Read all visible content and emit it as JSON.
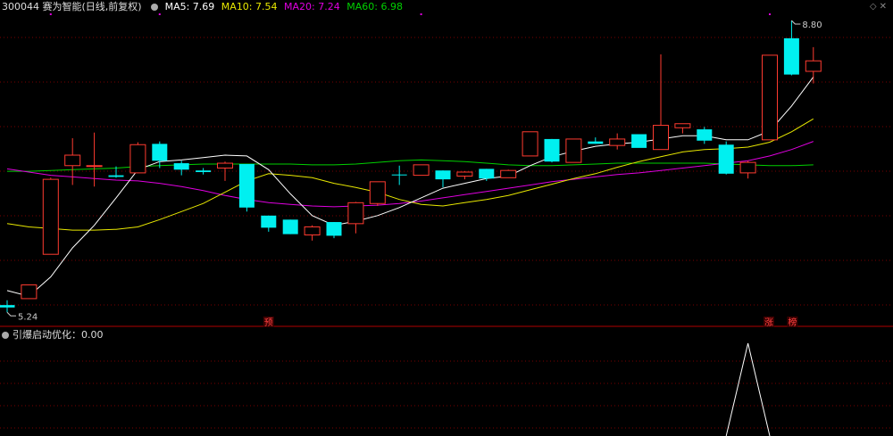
{
  "header": {
    "code_title": "300044 赛为智能(日线,前复权)",
    "ma5": "MA5: 7.69",
    "ma10": "MA10: 7.54",
    "ma20": "MA20: 7.24",
    "ma60": "MA60: 6.98"
  },
  "indicator": {
    "title": "引爆启动优化：0.00"
  },
  "markers": {
    "yu": "预",
    "zhang": "涨",
    "bang": "榜"
  },
  "icons": {
    "settings": "gear-icon",
    "nav": "diamond-icon",
    "close": "close-icon"
  },
  "colors": {
    "up": "#ff3b30",
    "down": "#00f0f0",
    "ma5": "#ffffff",
    "ma10": "#e8e800",
    "ma20": "#e000e0",
    "ma60": "#00d000",
    "grid": "#7a0000",
    "marker": "#ff4040"
  },
  "chart_data": [
    {
      "type": "candlestick",
      "title": "300044 赛为智能(日线,前复权)",
      "high_label": "8.80",
      "low_label": "5.24",
      "ylim": [
        5.15,
        8.9
      ],
      "candles": [
        {
          "o": 5.27,
          "h": 5.33,
          "l": 5.18,
          "c": 5.24
        },
        {
          "o": 5.35,
          "h": 5.52,
          "l": 5.35,
          "c": 5.52
        },
        {
          "o": 5.9,
          "h": 6.85,
          "l": 5.9,
          "c": 6.83
        },
        {
          "o": 7.0,
          "h": 7.34,
          "l": 6.76,
          "c": 7.13
        },
        {
          "o": 7.0,
          "h": 7.41,
          "l": 6.74,
          "c": 7.0
        },
        {
          "o": 6.88,
          "h": 6.99,
          "l": 6.85,
          "c": 6.86
        },
        {
          "o": 6.91,
          "h": 7.29,
          "l": 6.91,
          "c": 7.26
        },
        {
          "o": 7.27,
          "h": 7.3,
          "l": 6.97,
          "c": 7.06
        },
        {
          "o": 7.03,
          "h": 7.06,
          "l": 6.88,
          "c": 6.95
        },
        {
          "o": 6.94,
          "h": 6.97,
          "l": 6.89,
          "c": 6.92
        },
        {
          "o": 6.97,
          "h": 7.05,
          "l": 6.81,
          "c": 7.03
        },
        {
          "o": 7.02,
          "h": 7.02,
          "l": 6.43,
          "c": 6.48
        },
        {
          "o": 6.38,
          "h": 6.38,
          "l": 6.18,
          "c": 6.23
        },
        {
          "o": 6.33,
          "h": 6.33,
          "l": 6.15,
          "c": 6.15
        },
        {
          "o": 6.14,
          "h": 6.26,
          "l": 6.07,
          "c": 6.24
        },
        {
          "o": 6.3,
          "h": 6.3,
          "l": 6.1,
          "c": 6.13
        },
        {
          "o": 6.28,
          "h": 6.55,
          "l": 6.16,
          "c": 6.54
        },
        {
          "o": 6.53,
          "h": 6.8,
          "l": 6.5,
          "c": 6.8
        },
        {
          "o": 6.89,
          "h": 7.0,
          "l": 6.76,
          "c": 6.88
        },
        {
          "o": 6.88,
          "h": 7.01,
          "l": 6.88,
          "c": 7.01
        },
        {
          "o": 6.94,
          "h": 6.94,
          "l": 6.73,
          "c": 6.83
        },
        {
          "o": 6.87,
          "h": 6.93,
          "l": 6.83,
          "c": 6.92
        },
        {
          "o": 6.96,
          "h": 6.96,
          "l": 6.81,
          "c": 6.84
        },
        {
          "o": 6.85,
          "h": 6.95,
          "l": 6.85,
          "c": 6.94
        },
        {
          "o": 7.12,
          "h": 7.42,
          "l": 7.12,
          "c": 7.42
        },
        {
          "o": 7.33,
          "h": 7.33,
          "l": 7.04,
          "c": 7.05
        },
        {
          "o": 7.04,
          "h": 7.33,
          "l": 7.04,
          "c": 7.33
        },
        {
          "o": 7.3,
          "h": 7.35,
          "l": 7.27,
          "c": 7.27
        },
        {
          "o": 7.25,
          "h": 7.4,
          "l": 7.2,
          "c": 7.33
        },
        {
          "o": 7.39,
          "h": 7.39,
          "l": 7.23,
          "c": 7.22
        },
        {
          "o": 7.2,
          "h": 8.38,
          "l": 7.2,
          "c": 7.5
        },
        {
          "o": 7.47,
          "h": 7.5,
          "l": 7.4,
          "c": 7.52
        },
        {
          "o": 7.45,
          "h": 7.48,
          "l": 7.27,
          "c": 7.31
        },
        {
          "o": 7.26,
          "h": 7.3,
          "l": 6.89,
          "c": 6.9
        },
        {
          "o": 6.91,
          "h": 7.06,
          "l": 6.84,
          "c": 7.04
        },
        {
          "o": 7.32,
          "h": 8.37,
          "l": 7.32,
          "c": 8.37
        },
        {
          "o": 8.58,
          "h": 8.8,
          "l": 8.12,
          "c": 8.13
        },
        {
          "o": 8.17,
          "h": 8.47,
          "l": 8.02,
          "c": 8.3
        }
      ],
      "series": [
        {
          "name": "MA5",
          "values": [
            5.45,
            5.38,
            5.62,
            5.98,
            6.26,
            6.6,
            6.95,
            7.05,
            7.07,
            7.1,
            7.13,
            7.12,
            6.95,
            6.65,
            6.38,
            6.26,
            6.31,
            6.38,
            6.48,
            6.6,
            6.72,
            6.78,
            6.84,
            6.87,
            7.0,
            7.11,
            7.18,
            7.24,
            7.27,
            7.29,
            7.33,
            7.37,
            7.37,
            7.32,
            7.32,
            7.43,
            7.74,
            8.1
          ]
        },
        {
          "name": "MA10",
          "values": [
            6.28,
            6.24,
            6.22,
            6.2,
            6.2,
            6.21,
            6.24,
            6.33,
            6.43,
            6.53,
            6.67,
            6.81,
            6.9,
            6.88,
            6.85,
            6.78,
            6.73,
            6.67,
            6.58,
            6.52,
            6.5,
            6.54,
            6.58,
            6.63,
            6.7,
            6.77,
            6.84,
            6.9,
            6.98,
            7.05,
            7.11,
            7.17,
            7.2,
            7.21,
            7.23,
            7.29,
            7.42,
            7.58
          ]
        },
        {
          "name": "MA20",
          "values": [
            6.96,
            6.92,
            6.88,
            6.86,
            6.84,
            6.82,
            6.81,
            6.78,
            6.74,
            6.69,
            6.63,
            6.58,
            6.54,
            6.52,
            6.5,
            6.49,
            6.5,
            6.51,
            6.53,
            6.56,
            6.6,
            6.64,
            6.68,
            6.72,
            6.76,
            6.8,
            6.83,
            6.86,
            6.89,
            6.91,
            6.94,
            6.97,
            7.0,
            7.03,
            7.06,
            7.12,
            7.2,
            7.3
          ]
        },
        {
          "name": "MA60",
          "values": [
            6.93,
            6.93,
            6.94,
            6.95,
            6.96,
            6.97,
            6.99,
            7.0,
            7.01,
            7.02,
            7.02,
            7.02,
            7.02,
            7.02,
            7.01,
            7.01,
            7.02,
            7.04,
            7.06,
            7.07,
            7.06,
            7.05,
            7.03,
            7.01,
            7.0,
            7.0,
            7.01,
            7.02,
            7.03,
            7.03,
            7.03,
            7.03,
            7.03,
            7.02,
            7.01,
            7.0,
            7.0,
            7.01
          ]
        }
      ]
    },
    {
      "type": "line",
      "title": "引爆启动优化：0.00",
      "series": [
        {
          "name": "引爆启动优化",
          "values": [
            0,
            0,
            0,
            0,
            0,
            0,
            0,
            0,
            0,
            0,
            0,
            0,
            0,
            0,
            0,
            0,
            0,
            0,
            0,
            0,
            0,
            0,
            0,
            0,
            0,
            0,
            0,
            0,
            0,
            0,
            0,
            0,
            0,
            0,
            1,
            0,
            0,
            0
          ]
        }
      ]
    }
  ]
}
